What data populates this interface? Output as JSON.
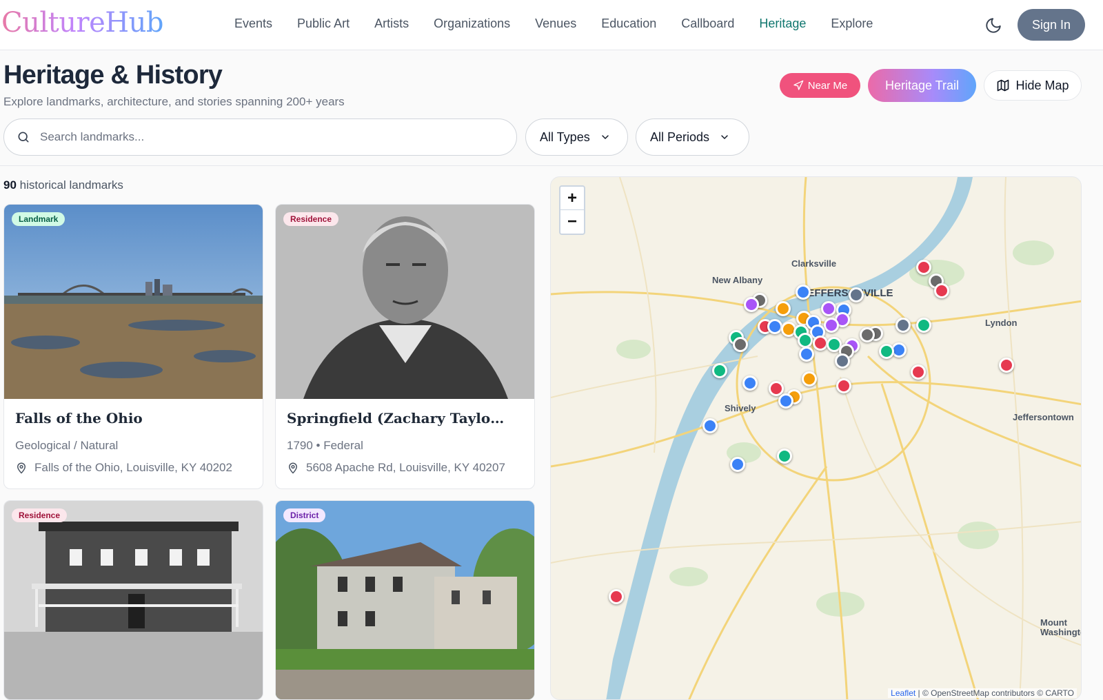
{
  "header": {
    "logo": "CultureHub",
    "nav": [
      "Events",
      "Public Art",
      "Artists",
      "Organizations",
      "Venues",
      "Education",
      "Callboard",
      "Heritage",
      "Explore"
    ],
    "active_nav": "Heritage",
    "sign_in": "Sign In"
  },
  "page": {
    "title": "Heritage & History",
    "subtitle": "Explore landmarks, architecture, and stories spanning 200+ years",
    "near_me": "Near Me",
    "heritage_trail": "Heritage Trail",
    "hide_map": "Hide Map"
  },
  "search": {
    "placeholder": "Search landmarks..."
  },
  "filters": {
    "types": "All Types",
    "periods": "All Periods"
  },
  "results": {
    "count": "90",
    "label": "historical landmarks"
  },
  "cards": [
    {
      "badge": "Landmark",
      "title": "Falls of the Ohio",
      "meta": "Geological / Natural",
      "address": "Falls of the Ohio, Louisville, KY 40202"
    },
    {
      "badge": "Residence",
      "title": "Springfield (Zachary Taylor...",
      "meta": "1790 • Federal",
      "address": "5608 Apache Rd, Louisville, KY 40207"
    },
    {
      "badge": "Residence",
      "title": "",
      "meta": "",
      "address": ""
    },
    {
      "badge": "District",
      "title": "",
      "meta": "",
      "address": ""
    }
  ],
  "map": {
    "labels": [
      "Clarksville",
      "New Albany",
      "JEFFERSONVILLE",
      "Lyndon",
      "Shively",
      "Jeffersontown",
      "Mount Washington"
    ],
    "zoom_in": "+",
    "zoom_out": "−",
    "attribution_links": [
      "Leaflet",
      "OpenStreetMap",
      "CARTO"
    ],
    "attribution_text": "| © OpenStreetMap contributors © CARTO"
  },
  "colors": {
    "accent": "#0f766e",
    "pin_red": "#e63950",
    "pin_blue": "#3b82f6",
    "pin_green": "#10b981",
    "pin_purple": "#a855f7",
    "pin_orange": "#f59e0b",
    "pin_gray": "#64748b"
  }
}
